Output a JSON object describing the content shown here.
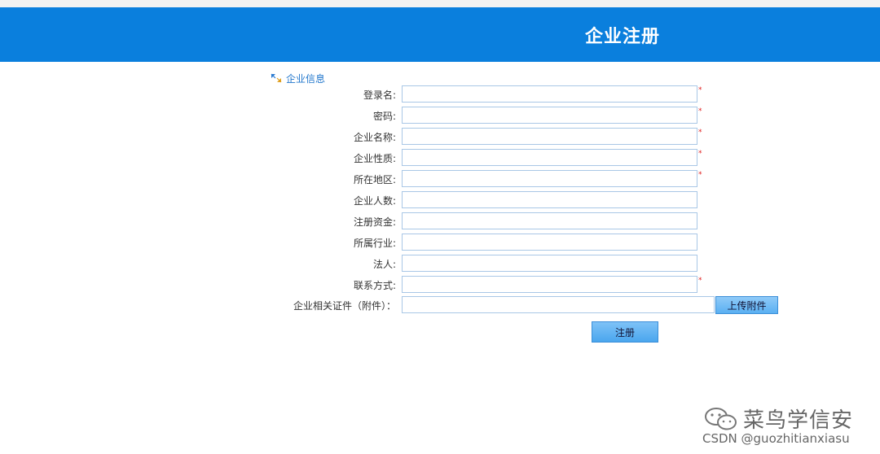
{
  "header": {
    "title": "企业注册"
  },
  "section": {
    "title": "企业信息",
    "icon": "resize-arrows-icon"
  },
  "form": {
    "fields": [
      {
        "label": "登录名:",
        "value": "",
        "required": "*"
      },
      {
        "label": "密码:",
        "value": "",
        "required": "*"
      },
      {
        "label": "企业名称:",
        "value": "",
        "required": "*"
      },
      {
        "label": "企业性质:",
        "value": "",
        "required": "*"
      },
      {
        "label": "所在地区:",
        "value": "",
        "required": "*"
      },
      {
        "label": "企业人数:",
        "value": ""
      },
      {
        "label": "注册资金:",
        "value": ""
      },
      {
        "label": "所属行业:",
        "value": ""
      },
      {
        "label": "法人:",
        "value": ""
      },
      {
        "label": "联系方式:",
        "value": "",
        "required": "*"
      }
    ],
    "attachment": {
      "label": "企业相关证件（附件）：",
      "value": "",
      "button": "上传附件"
    },
    "submit": "注册"
  },
  "watermark": {
    "brand": "菜鸟学信安",
    "csdn": "CSDN @guozhitianxiasu",
    "icon": "wechat-icon"
  },
  "colors": {
    "header": "#0a7fdd",
    "link": "#2277cc",
    "required": "#e02020",
    "button": "#5ab0f2"
  }
}
